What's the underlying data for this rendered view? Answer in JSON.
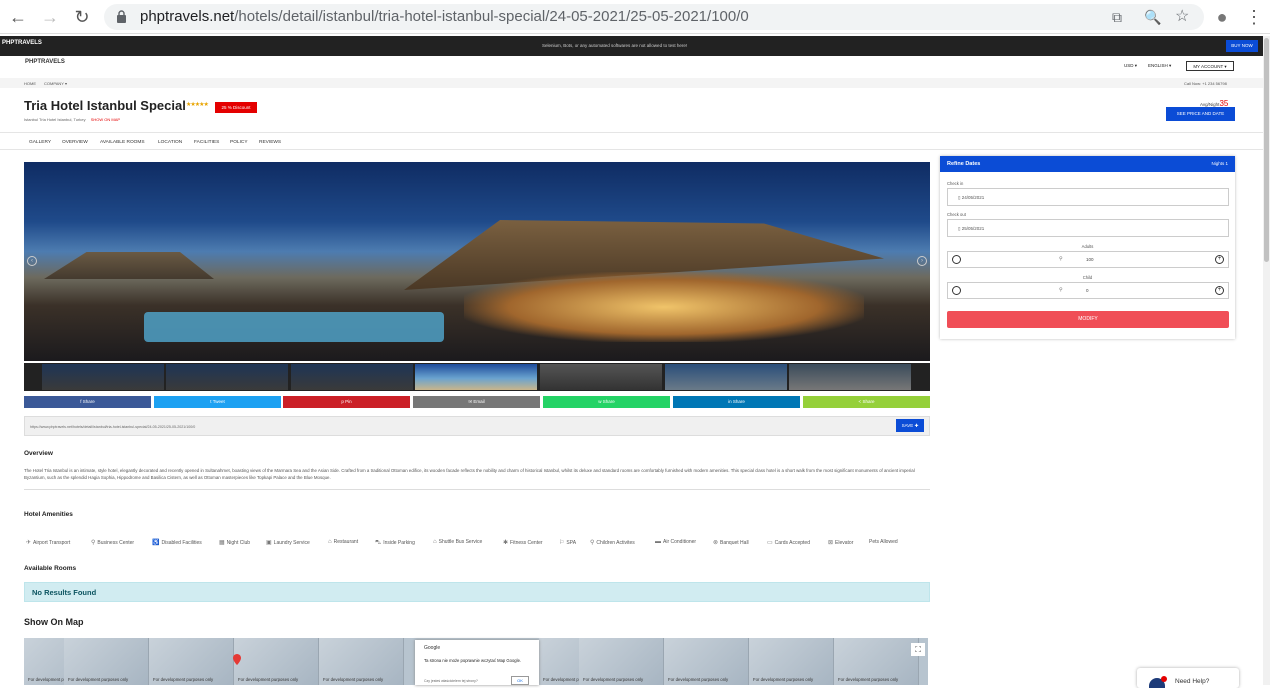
{
  "browser": {
    "url_domain": "phptravels.net",
    "url_path": "/hotels/detail/istanbul/tria-hotel-istanbul-special/24-05-2021/25-05-2021/100/0",
    "back": "←",
    "forward": "→",
    "reload": "↻",
    "translate_icon": "⧉",
    "zoom_icon": "🔍",
    "star_icon": "☆",
    "profile_icon": "●",
    "menu_icon": "⋮"
  },
  "topbar": {
    "logo": "PHPTRAVELS",
    "notice": "Selenium, Bots, or any automated softwares are not allowed to test here!",
    "buy_now": "BUY NOW"
  },
  "header": {
    "brand": "PHPTRAVELS",
    "currency": "USD ▾",
    "language": "ENGLISH ▾",
    "account": "MY ACCOUNT ▾",
    "home": "HOME",
    "company": "COMPANY ▾",
    "call": "Call Now: +1 234 56798"
  },
  "hotel": {
    "name": "Tria Hotel Istanbul Special",
    "stars": "★★★★★",
    "discount": "25 % Discount",
    "location": "Istanbul Tria Hotel Istanbul, Turkey",
    "show_on_map": "SHOW ON MAP",
    "avg_label": "Avg/Night",
    "avg_price": "35",
    "see_price": "SEE PRICE AND DATE"
  },
  "tabs": [
    "GALLERY",
    "OVERVIEW",
    "AVAILABLE ROOMS",
    "LOCATION",
    "FACILITIES",
    "POLICY",
    "REVIEWS"
  ],
  "share_buttons": [
    {
      "label": "Share",
      "icon": "f",
      "color": "#3b5998"
    },
    {
      "label": "Tweet",
      "icon": "t",
      "color": "#1da1f2"
    },
    {
      "label": "Pin",
      "icon": "p",
      "color": "#cb2027"
    },
    {
      "label": "Email",
      "icon": "✉",
      "color": "#777777"
    },
    {
      "label": "Share",
      "icon": "w",
      "color": "#25d366"
    },
    {
      "label": "Share",
      "icon": "in",
      "color": "#0077b5"
    },
    {
      "label": "Share",
      "icon": "<",
      "color": "#95d03a"
    }
  ],
  "share_url": "https://www.phptravels.net/hotels/detail/istanbul/tria-hotel-istanbul-special/24-05-2021/25-05-2021/100/0",
  "save_label": "SAVE",
  "overview": {
    "heading": "Overview",
    "text": "The Hotel Tria Istanbul is an intimate, style hotel, elegantly decorated and recently opened in Sultanahmet, boasting views of the Marmara Sea and the Asian Side. Crafted from a traditional Ottoman edifice, its wooden facade reflects the nobility and charm of historical Istanbul, whilst its deluxe and standard rooms are comfortably furnished with modern amenities. This special class hotel is a short walk from the most significant monuments of ancient imperial Byzantium, such as the splendid Hagia Sophia, Hippodrome and Basilica Cistern, as well as Ottoman masterpieces like Topkapi Palace and the Blue Mosque."
  },
  "amenities": {
    "heading": "Hotel Amenities",
    "items": [
      "Airport Transport",
      "Business Center",
      "Disabled Facilities",
      "Night Club",
      "Laundry Service",
      "Restaurant",
      "Inside Parking",
      "Shuttle Bus Service",
      "Fitness Center",
      "SPA",
      "Children Activites",
      "Air Conditioner",
      "Banquet Hall",
      "Cards Accepted",
      "Elevator",
      "Pets Allowed"
    ]
  },
  "rooms": {
    "heading": "Available Rooms",
    "empty": "No Results Found"
  },
  "map": {
    "heading": "Show On Map",
    "watermark": "For development purposes only",
    "dialog_brand": "Google",
    "dialog_message": "Ta strona nie może poprawnie wczytać Map Google.",
    "dialog_question": "Czy jesteś właścicielem tej strony?",
    "dialog_ok": "OK"
  },
  "refine": {
    "title": "Refine Dates",
    "nights": "Nights 1",
    "checkin_label": "Check in",
    "checkin": "24/05/2021",
    "checkout_label": "Check out",
    "checkout": "25/05/2021",
    "adults_label": "Adults",
    "adults": "100",
    "child_label": "Child",
    "child": "0",
    "modify": "MODIFY"
  },
  "help": "Need Help?"
}
